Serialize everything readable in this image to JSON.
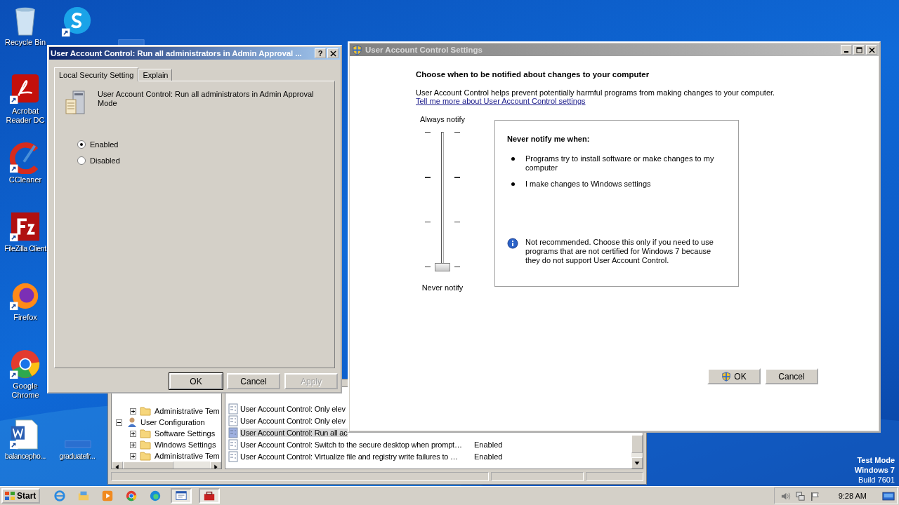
{
  "desktop": {
    "icons": [
      {
        "kind": "recycle",
        "label": "Recycle Bin"
      },
      {
        "kind": "skype"
      },
      {
        "kind": "blank"
      },
      {
        "kind": "acrobat",
        "label": "Acrobat Reader DC"
      },
      {
        "kind": "ccleaner",
        "label": "CCleaner"
      },
      {
        "kind": "filezilla",
        "label": "FileZilla Client"
      },
      {
        "kind": "firefox",
        "label": "Firefox"
      },
      {
        "kind": "chrome",
        "label": "Google Chrome"
      },
      {
        "kind": "word",
        "label": "balancepho..."
      },
      {
        "kind": "blank",
        "label": "graduatefr..."
      }
    ],
    "os_notice": [
      "Test Mode",
      "Windows 7",
      "Build 7601"
    ]
  },
  "background_window": {
    "tree": [
      {
        "label": "Administrative Tem",
        "expanded": false
      },
      {
        "label": "User Configuration",
        "expanded": true,
        "children": [
          {
            "label": "Software Settings",
            "expanded": false
          },
          {
            "label": "Windows Settings",
            "expanded": false
          },
          {
            "label": "Administrative Tem",
            "expanded": false
          }
        ]
      }
    ],
    "policies": [
      {
        "name": "User Account Control: Only elev",
        "selected": false
      },
      {
        "name": "User Account Control: Only elev",
        "selected": false
      },
      {
        "name": "User Account Control: Run all ac",
        "selected": true
      },
      {
        "name": "User Account Control: Switch to the secure desktop when prompt…",
        "setting": "Enabled",
        "selected": false
      },
      {
        "name": "User Account Control: Virtualize file and registry write failures to …",
        "setting": "Enabled",
        "selected": false
      }
    ]
  },
  "policy_dialog": {
    "title": "User Account Control: Run all administrators in Admin Approval ...",
    "help": "?",
    "tabs": [
      {
        "label": "Local Security Setting",
        "selected": true
      },
      {
        "label": "Explain",
        "selected": false
      }
    ],
    "policy_name": "User Account Control: Run all administrators in Admin Approval Mode",
    "options": [
      {
        "label": "Enabled",
        "selected": true
      },
      {
        "label": "Disabled",
        "selected": false
      }
    ],
    "buttons": [
      {
        "label": "OK",
        "disabled": false,
        "default": true
      },
      {
        "label": "Cancel",
        "disabled": false,
        "default": false
      },
      {
        "label": "Apply",
        "disabled": true,
        "default": false
      }
    ]
  },
  "uac_window": {
    "title": "User Account Control Settings",
    "heading": "Choose when to be notified about changes to your computer",
    "description": "User Account Control helps prevent potentially harmful programs from making changes to your computer.",
    "link": "Tell me more about User Account Control settings",
    "slider": {
      "top_label": "Always notify",
      "bottom_label": "Never notify",
      "level": 0
    },
    "info": {
      "heading": "Never notify me when:",
      "bullets": [
        "Programs try to install software or make changes to my computer",
        "I make changes to Windows settings"
      ],
      "note": "Not recommended. Choose this only if you need to use programs that are not certified for Windows 7 because they do not support User Account Control."
    },
    "buttons": [
      {
        "label": "OK",
        "shield": true
      },
      {
        "label": "Cancel",
        "shield": false
      }
    ]
  },
  "taskbar": {
    "start": "Start",
    "apps": [
      {
        "kind": "ie",
        "active": false
      },
      {
        "kind": "explorer",
        "active": false
      },
      {
        "kind": "media",
        "active": false
      },
      {
        "kind": "chrome",
        "active": false
      },
      {
        "kind": "edge",
        "active": false
      },
      {
        "kind": "console",
        "active": true
      },
      {
        "kind": "toolbox",
        "active": true
      }
    ],
    "clock": "9:28 AM"
  }
}
